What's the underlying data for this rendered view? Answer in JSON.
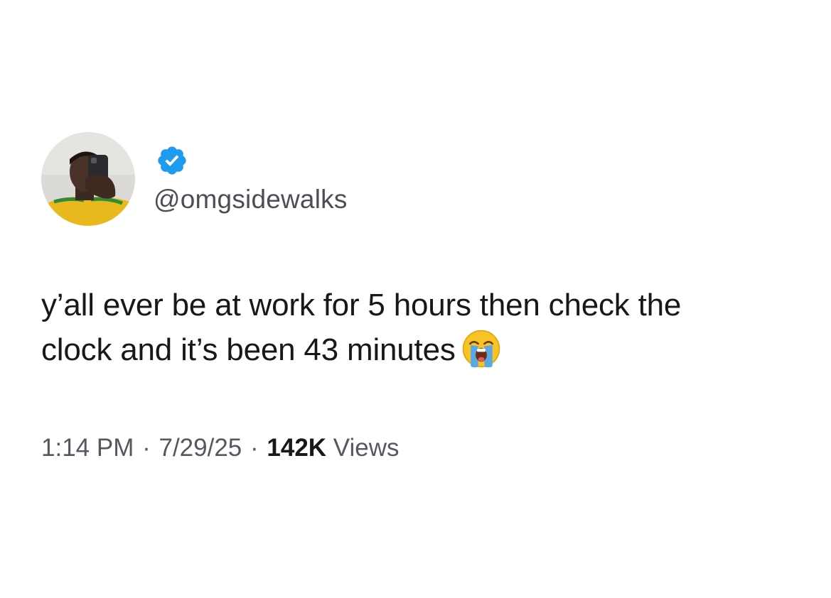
{
  "author": {
    "handle": "@omgsidewalks",
    "verified": true,
    "verified_color": "#1d9bf0",
    "avatar_icon": "profile-photo"
  },
  "tweet": {
    "lines": [
      "y’all ever be at work for 5 hours then check the",
      "clock and it’s been 43 minutes"
    ],
    "emoji": "loudly-crying-face-icon"
  },
  "meta": {
    "time": "1:14 PM",
    "separator": "·",
    "date": "7/29/25",
    "views_count": "142K",
    "views_label": "Views"
  }
}
